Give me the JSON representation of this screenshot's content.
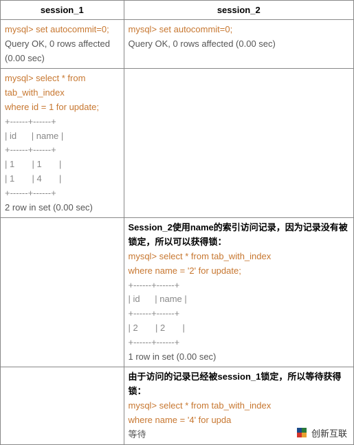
{
  "headers": {
    "col1": "session_1",
    "col2": "session_2"
  },
  "row1": {
    "s1_cmd": "mysql> set autocommit=0;",
    "s1_res": "Query OK, 0 rows affected (0.00 sec)",
    "s2_cmd": "mysql> set autocommit=0;",
    "s2_res": "Query OK, 0 rows affected (0.00 sec)"
  },
  "row2": {
    "s1_cmd1": "mysql> select * from tab_with_index",
    "s1_cmd2": "where id = 1 for update;",
    "s1_border": "+------+------+",
    "s1_header": "| id      | name |",
    "s1_data1": "| 1       | 1       |",
    "s1_data2": "| 1       | 4       |",
    "s1_footer": "2 row in set (0.00 sec)"
  },
  "row3": {
    "s2_note": "Session_2使用name的索引访问记录，因为记录没有被锁定，所以可以获得锁：",
    "s2_cmd1": "mysql> select * from tab_with_index",
    "s2_cmd2": "where name = '2' for update;",
    "s2_border": "+------+------+",
    "s2_header": "| id      | name |",
    "s2_data1": "| 2       | 2       |",
    "s2_footer": "1 row in set (0.00 sec)"
  },
  "row4": {
    "s2_note": "由于访问的记录已经被session_1锁定，所以等待获得锁：",
    "s2_cmd1": "mysql> select * from tab_with_index",
    "s2_cmd2": "where name = '4' for upda",
    "s2_wait": "等待"
  },
  "watermark": {
    "text": "创新互联"
  }
}
